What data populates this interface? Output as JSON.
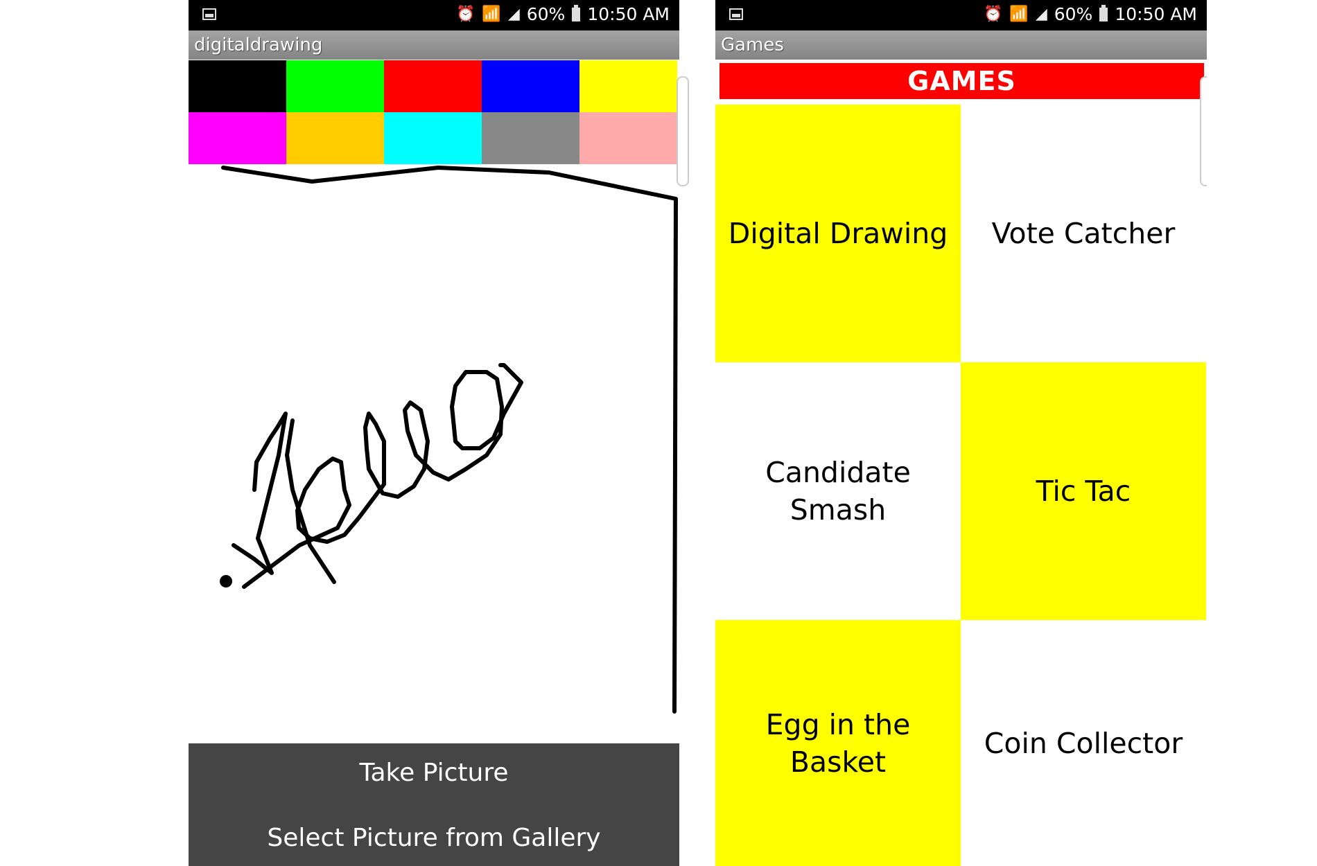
{
  "left_screen": {
    "status_bar": {
      "battery": "60%",
      "time": "10:50 AM"
    },
    "app_title": "digitaldrawing",
    "palette": [
      "#000000",
      "#00ff00",
      "#ff0000",
      "#0000ff",
      "#ffff00",
      "#ff00ff",
      "#ffcc00",
      "#00ffff",
      "#888888",
      "#ffaaaa"
    ],
    "buttons": {
      "take_picture": "Take Picture",
      "select_picture": "Select Picture from Gallery"
    }
  },
  "right_screen": {
    "status_bar": {
      "battery": "60%",
      "time": "10:50 AM"
    },
    "app_title": "Games",
    "header": "GAMES",
    "games": [
      {
        "label": "Digital Drawing",
        "highlight": true
      },
      {
        "label": "Vote Catcher",
        "highlight": false
      },
      {
        "label": "Candidate Smash",
        "highlight": false
      },
      {
        "label": "Tic Tac",
        "highlight": true
      },
      {
        "label": "Egg in the Basket",
        "highlight": true
      },
      {
        "label": "Coin Collector",
        "highlight": false
      }
    ]
  }
}
